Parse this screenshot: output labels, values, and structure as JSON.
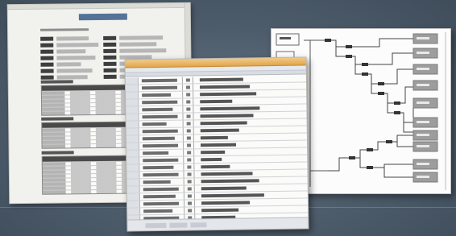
{
  "scene": {
    "background": "#4a5968",
    "documents": [
      {
        "kind": "report",
        "sections": 3
      },
      {
        "kind": "spreadsheet",
        "rows": 22,
        "accent": "#e0a74b"
      },
      {
        "kind": "tree-diagram",
        "leaf_boxes": 13,
        "leaf_color": "#9d9d9d"
      }
    ]
  }
}
